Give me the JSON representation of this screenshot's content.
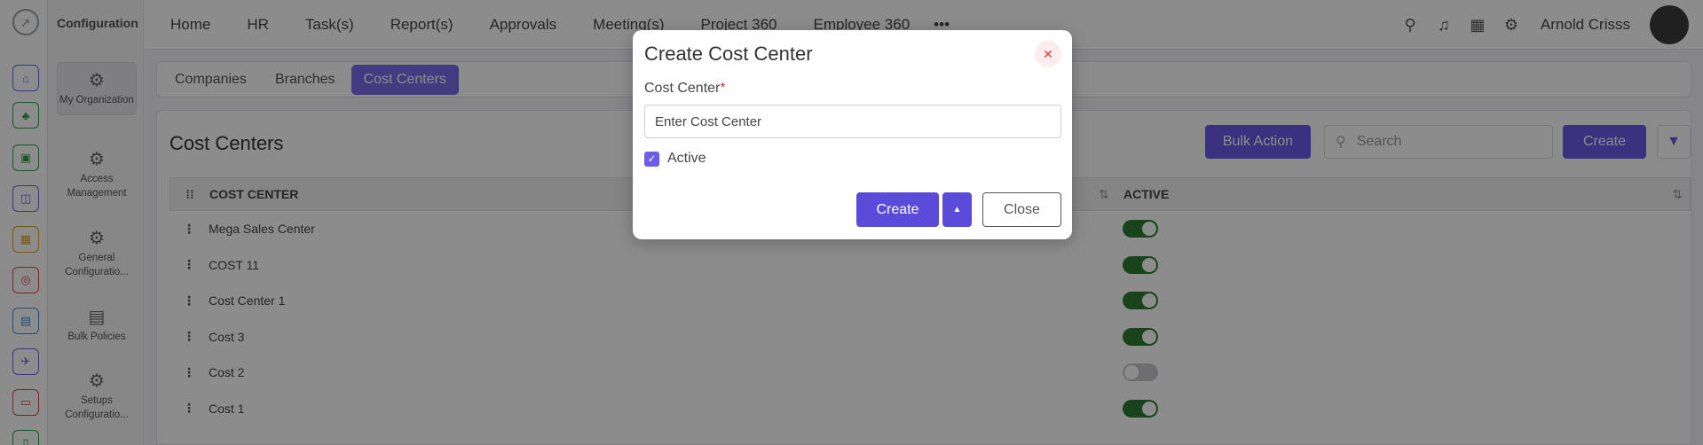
{
  "app": {
    "section_title": "Configuration"
  },
  "rail": {
    "icons": [
      {
        "name": "home",
        "color": "#5b6ef5"
      },
      {
        "name": "tree",
        "color": "#2e9e4f"
      },
      {
        "name": "briefcase",
        "color": "#2e9e4f"
      },
      {
        "name": "box",
        "color": "#7b5be8"
      },
      {
        "name": "calendar",
        "color": "#e0a020"
      },
      {
        "name": "target",
        "color": "#e04848"
      },
      {
        "name": "archive",
        "color": "#3c8ed8"
      },
      {
        "name": "plane",
        "color": "#7b5be8"
      },
      {
        "name": "chat",
        "color": "#e04848"
      },
      {
        "name": "doc",
        "color": "#2e9e4f"
      }
    ]
  },
  "subnav": {
    "items": [
      {
        "label": "My Organization",
        "icon": "org-icon"
      },
      {
        "label": "Access Management",
        "icon": "gear-icon"
      },
      {
        "label": "General Configuratio...",
        "icon": "gear-icon"
      },
      {
        "label": "Bulk Policies",
        "icon": "policy-icon"
      },
      {
        "label": "Setups Configuratio...",
        "icon": "gear-icon"
      }
    ]
  },
  "topnav": {
    "items": [
      "Home",
      "HR",
      "Task(s)",
      "Report(s)",
      "Approvals",
      "Meeting(s)",
      "Project 360",
      "Employee 360"
    ],
    "more": "•••",
    "user_name": "Arnold Crisss"
  },
  "tabs": {
    "items": [
      "Companies",
      "Branches",
      "Cost Centers"
    ],
    "active_index": 2
  },
  "page": {
    "title": "Cost Centers",
    "bulk_action_label": "Bulk Action",
    "search_placeholder": "Search",
    "create_label": "Create"
  },
  "table": {
    "columns": [
      "COST CENTER",
      "ACTIVE"
    ],
    "rows": [
      {
        "name": "Mega Sales Center",
        "active": true
      },
      {
        "name": "COST 11",
        "active": true
      },
      {
        "name": "Cost Center 1",
        "active": true
      },
      {
        "name": "Cost 3",
        "active": true
      },
      {
        "name": "Cost 2",
        "active": false
      },
      {
        "name": "Cost 1",
        "active": true
      }
    ]
  },
  "modal": {
    "title": "Create Cost Center",
    "field_label": "Cost Center",
    "required_mark": "*",
    "field_placeholder": "Enter Cost Center",
    "active_label": "Active",
    "active_checked": true,
    "create_label": "Create",
    "close_label": "Close"
  }
}
